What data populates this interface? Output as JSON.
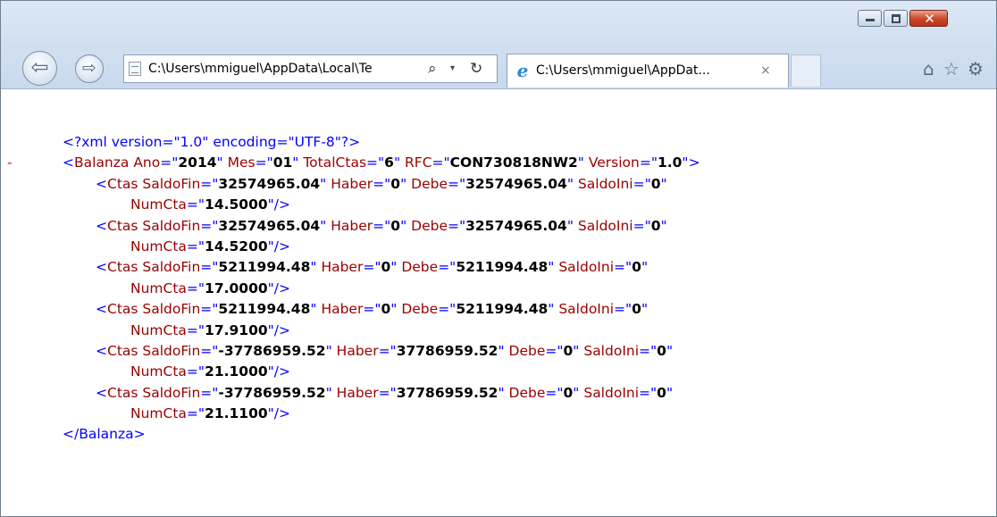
{
  "address_bar": {
    "url": "C:\\Users\\mmiguel\\AppData\\Local\\Te"
  },
  "tab": {
    "title": "C:\\Users\\mmiguel\\AppDat...",
    "close_label": "×"
  },
  "window_buttons": {
    "minimize": "minimize-icon",
    "maximize": "maximize-icon",
    "close": "✕"
  },
  "nav": {
    "back": "⇦",
    "forward": "⇨"
  },
  "icons": {
    "search": "⚲",
    "dropdown": "▾",
    "refresh": "↻",
    "home": "⌂",
    "favorites": "☆",
    "tools": "⚙",
    "ie": "e"
  },
  "xml": {
    "declaration": "<?xml version=\"1.0\" encoding=\"UTF-8\"?>",
    "collapse_marker": "-",
    "root": {
      "tag": "Balanza",
      "attrs": [
        {
          "name": "Ano",
          "value": "2014"
        },
        {
          "name": "Mes",
          "value": "01"
        },
        {
          "name": "TotalCtas",
          "value": "6"
        },
        {
          "name": "RFC",
          "value": "CON730818NW2"
        },
        {
          "name": "Version",
          "value": "1.0"
        }
      ],
      "closing": "</Balanza>"
    },
    "ctas": [
      {
        "SaldoFin": "32574965.04",
        "Haber": "0",
        "Debe": "32574965.04",
        "SaldoIni": "0",
        "NumCta": "14.5000"
      },
      {
        "SaldoFin": "32574965.04",
        "Haber": "0",
        "Debe": "32574965.04",
        "SaldoIni": "0",
        "NumCta": "14.5200"
      },
      {
        "SaldoFin": "5211994.48",
        "Haber": "0",
        "Debe": "5211994.48",
        "SaldoIni": "0",
        "NumCta": "17.0000"
      },
      {
        "SaldoFin": "5211994.48",
        "Haber": "0",
        "Debe": "5211994.48",
        "SaldoIni": "0",
        "NumCta": "17.9100"
      },
      {
        "SaldoFin": "-37786959.52",
        "Haber": "37786959.52",
        "Debe": "0",
        "SaldoIni": "0",
        "NumCta": "21.1000"
      },
      {
        "SaldoFin": "-37786959.52",
        "Haber": "37786959.52",
        "Debe": "0",
        "SaldoIni": "0",
        "NumCta": "21.1100"
      }
    ]
  },
  "colors": {
    "tag": "#0000ff",
    "attr_name": "#990000",
    "attr_value": "#000000",
    "collapse": "#ff0000",
    "chrome": "#d2e0f1"
  }
}
